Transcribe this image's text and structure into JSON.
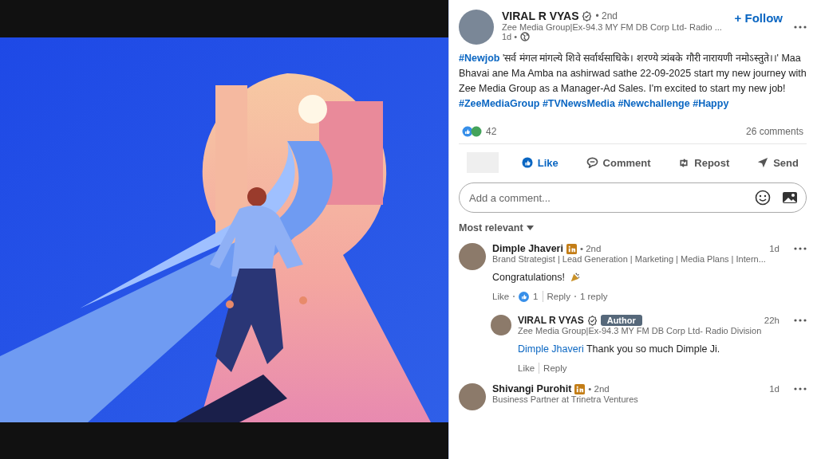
{
  "post": {
    "author": {
      "name": "VIRAL R VYAS",
      "verified": true,
      "degree": "• 2nd",
      "headline": "Zee Media Group|Ex-94.3 MY FM DB Corp Ltd- Radio ...",
      "time": "1d •"
    },
    "follow_label": "+ Follow",
    "body": [
      {
        "kind": "hashtag",
        "text": "#Newjob"
      },
      {
        "kind": "plain",
        "text": " 'सर्व मंगल मांगल्ये शिवे सर्वार्थसाधिके। शरण्ये त्र्यंबके गौरी नारायणी नमोऽस्तुते।।' Maa Bhavai ane Ma Amba na ashirwad sathe 22-09-2025 start my new journey with Zee Media Group as a Manager-Ad Sales. I'm excited to start my new job! "
      },
      {
        "kind": "hashtag",
        "text": "#ZeeMediaGroup"
      },
      {
        "kind": "hashtag",
        "text": " #TVNewsMedia"
      },
      {
        "kind": "hashtag",
        "text": " #Newchallenge"
      },
      {
        "kind": "hashtag",
        "text": " #Happy"
      }
    ],
    "reactions_count": "42",
    "comments_count": "26 comments",
    "actions": [
      {
        "kind": "like",
        "label": "Like",
        "selected": true
      },
      {
        "kind": "comment",
        "label": "Comment",
        "selected": false
      },
      {
        "kind": "repost",
        "label": "Repost",
        "selected": false
      },
      {
        "kind": "send",
        "label": "Send",
        "selected": false
      }
    ],
    "comment_box": {
      "placeholder": "Add a comment..."
    },
    "sort": {
      "label": "Most relevant"
    }
  },
  "comments": [
    {
      "name": "Dimple Jhaveri",
      "premium": true,
      "degree": "• 2nd",
      "headline": "Brand Strategist | Lead Generation | Marketing | Media Plans | Intern...",
      "time": "1d",
      "body": [
        {
          "kind": "plain",
          "text": "Congratulations!"
        }
      ],
      "celebration": true,
      "like_label": "Like",
      "like_count": "1",
      "reply_label": "Reply",
      "reply_count": "1 reply",
      "replies": [
        {
          "name": "VIRAL R VYAS",
          "verified": true,
          "badge": "Author",
          "headline": "Zee Media Group|Ex-94.3 MY FM DB Corp Ltd- Radio Division",
          "time": "22h",
          "body": [
            {
              "kind": "mention",
              "text": "Dimple Jhaveri"
            },
            {
              "kind": "plain",
              "text": " Thank you so much Dimple Ji."
            }
          ],
          "like_label": "Like",
          "reply_label": "Reply"
        }
      ]
    },
    {
      "name": "Shivangi Purohit",
      "premium": true,
      "degree": "• 2nd",
      "headline": "Business Partner at Trinetra Ventures",
      "time": "1d"
    }
  ]
}
